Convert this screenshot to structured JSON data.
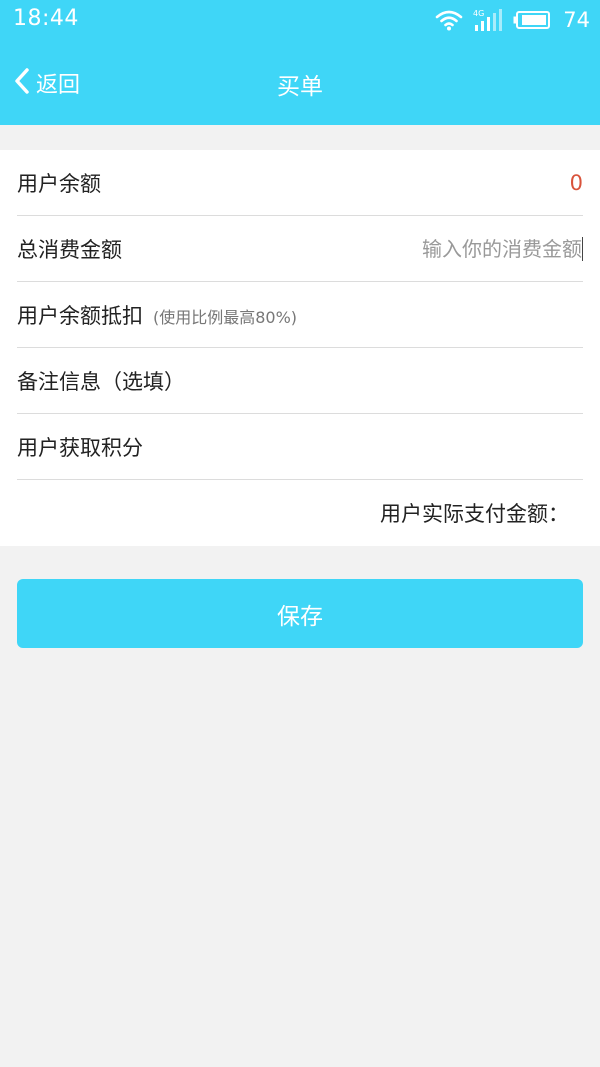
{
  "status_bar": {
    "time": "18:44",
    "network_label": "4G",
    "battery_level": "74"
  },
  "nav": {
    "back_label": "返回",
    "title": "买单"
  },
  "form": {
    "balance": {
      "label": "用户余额",
      "value": "0"
    },
    "total_amount": {
      "label": "总消费金额",
      "placeholder": "输入你的消费金额"
    },
    "deduction": {
      "label": "用户余额抵扣",
      "hint": "(使用比例最高80%)"
    },
    "remark": {
      "label": "备注信息（选填）"
    },
    "points": {
      "label": "用户获取积分"
    },
    "actual_pay": {
      "label": "用户实际支付金额："
    }
  },
  "save_button": {
    "label": "保存"
  },
  "colors": {
    "accent": "#3fd6f7",
    "value_red": "#d9533b",
    "background": "#f2f2f2"
  },
  "icons": {
    "back": "chevron-left-icon",
    "wifi": "wifi-icon",
    "signal": "signal-icon",
    "battery": "battery-icon"
  }
}
